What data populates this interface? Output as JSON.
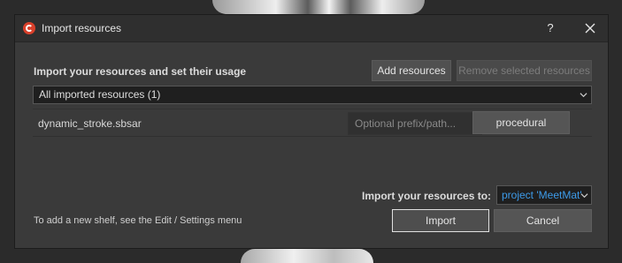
{
  "window": {
    "title": "Import resources",
    "help_label": "?",
    "app_icon": "substance-logo-icon",
    "close_icon": "close-icon"
  },
  "main": {
    "heading": "Import your resources and set their usage",
    "add_button": "Add resources",
    "remove_button": "Remove selected resources",
    "filter_selected": "All imported resources (1)",
    "resources": [
      {
        "name": "dynamic_stroke.sbsar",
        "prefix_value": "",
        "prefix_placeholder": "Optional prefix/path...",
        "usage": "procedural"
      }
    ]
  },
  "footer": {
    "import_to_label": "Import your resources to:",
    "project_selected": "project 'MeetMat'",
    "hint": "To add a new shelf, see the Edit / Settings menu",
    "import_button": "Import",
    "cancel_button": "Cancel"
  },
  "colors": {
    "accent_link": "#3d9be9",
    "brand_icon": "#d9402b",
    "dialog_bg": "#3a3a3a"
  }
}
